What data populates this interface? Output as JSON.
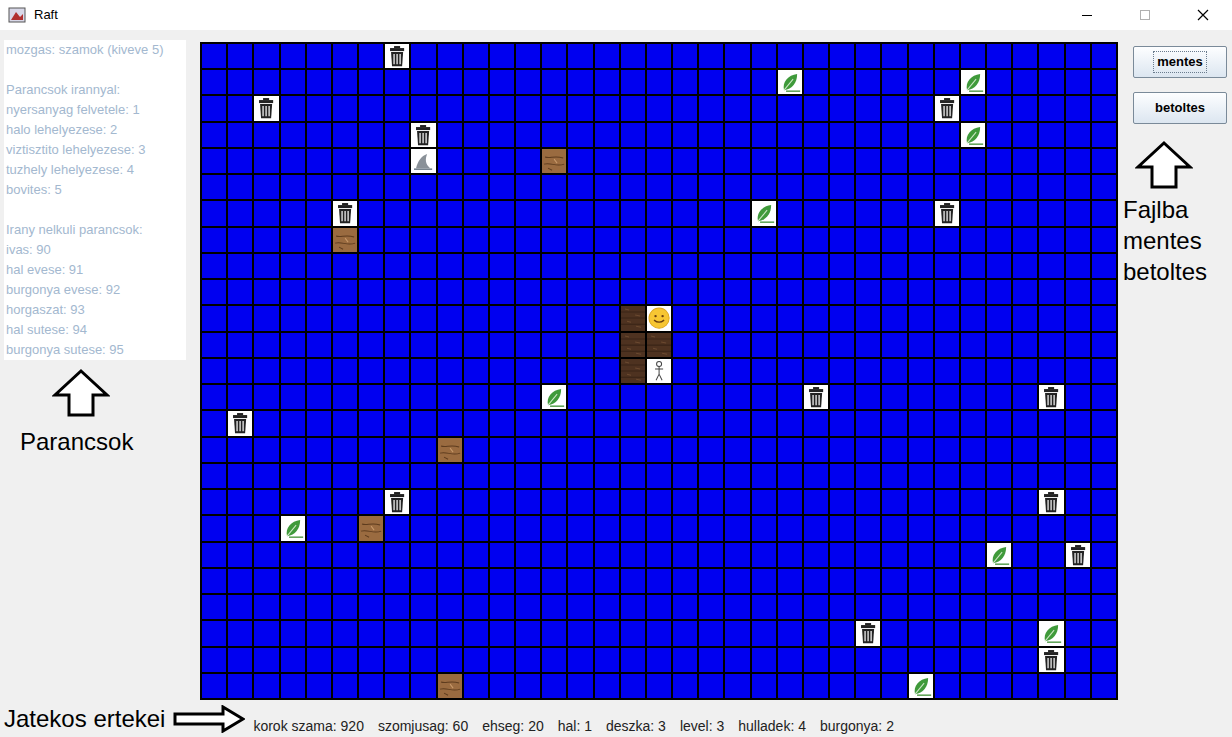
{
  "window": {
    "title": "Raft"
  },
  "commands": {
    "groups": [
      {
        "lines": [
          "mozgas: szamok (kiveve 5)"
        ]
      },
      {
        "lines": [
          "Parancsok irannyal:",
          "nyersanyag felvetele: 1",
          "halo lehelyezese: 2",
          "viztisztito lehelyezese: 3",
          "tuzhely lehelyezese: 4",
          "bovites: 5"
        ]
      },
      {
        "lines": [
          "Irany nelkuli parancsok:",
          "ivas: 90",
          "hal evese: 91",
          "burgonya evese: 92",
          "horgaszat: 93",
          "hal sutese: 94",
          "burgonya sutese: 95"
        ]
      }
    ]
  },
  "annotations": {
    "commands": "Parancsok",
    "file": [
      "Fajlba",
      "mentes",
      "betoltes"
    ],
    "player": "Jatekos ertekei"
  },
  "buttons": [
    {
      "label": "mentes",
      "focused": true
    },
    {
      "label": "betoltes",
      "focused": false
    }
  ],
  "grid": {
    "rows": 25,
    "cols": 35,
    "cells": [
      {
        "row": 0,
        "col": 7,
        "kind": "trash"
      },
      {
        "row": 1,
        "col": 22,
        "kind": "leaf"
      },
      {
        "row": 1,
        "col": 29,
        "kind": "leaf"
      },
      {
        "row": 2,
        "col": 2,
        "kind": "trash"
      },
      {
        "row": 2,
        "col": 28,
        "kind": "trash"
      },
      {
        "row": 3,
        "col": 8,
        "kind": "trash"
      },
      {
        "row": 3,
        "col": 29,
        "kind": "leaf"
      },
      {
        "row": 4,
        "col": 8,
        "kind": "shark"
      },
      {
        "row": 4,
        "col": 13,
        "kind": "plank"
      },
      {
        "row": 6,
        "col": 5,
        "kind": "trash"
      },
      {
        "row": 6,
        "col": 21,
        "kind": "leaf"
      },
      {
        "row": 6,
        "col": 28,
        "kind": "trash"
      },
      {
        "row": 7,
        "col": 5,
        "kind": "plank"
      },
      {
        "row": 10,
        "col": 16,
        "kind": "raft"
      },
      {
        "row": 10,
        "col": 17,
        "kind": "player"
      },
      {
        "row": 11,
        "col": 16,
        "kind": "raft"
      },
      {
        "row": 11,
        "col": 17,
        "kind": "raft"
      },
      {
        "row": 12,
        "col": 16,
        "kind": "raft"
      },
      {
        "row": 12,
        "col": 17,
        "kind": "device"
      },
      {
        "row": 13,
        "col": 13,
        "kind": "leaf"
      },
      {
        "row": 13,
        "col": 23,
        "kind": "trash"
      },
      {
        "row": 13,
        "col": 32,
        "kind": "trash"
      },
      {
        "row": 14,
        "col": 1,
        "kind": "trash"
      },
      {
        "row": 15,
        "col": 9,
        "kind": "plank"
      },
      {
        "row": 17,
        "col": 7,
        "kind": "trash"
      },
      {
        "row": 17,
        "col": 32,
        "kind": "trash"
      },
      {
        "row": 18,
        "col": 3,
        "kind": "leaf"
      },
      {
        "row": 18,
        "col": 6,
        "kind": "plank"
      },
      {
        "row": 19,
        "col": 30,
        "kind": "leaf"
      },
      {
        "row": 19,
        "col": 33,
        "kind": "trash"
      },
      {
        "row": 22,
        "col": 25,
        "kind": "trash"
      },
      {
        "row": 22,
        "col": 32,
        "kind": "leaf"
      },
      {
        "row": 23,
        "col": 32,
        "kind": "trash"
      },
      {
        "row": 24,
        "col": 9,
        "kind": "plank"
      },
      {
        "row": 24,
        "col": 27,
        "kind": "leaf"
      }
    ]
  },
  "status_bar": [
    "korok szama: 920",
    "szomjusag: 60",
    "ehseg: 20",
    "hal: 1",
    "deszka: 3",
    "level: 3",
    "hulladek: 4",
    "burgonya: 2"
  ]
}
